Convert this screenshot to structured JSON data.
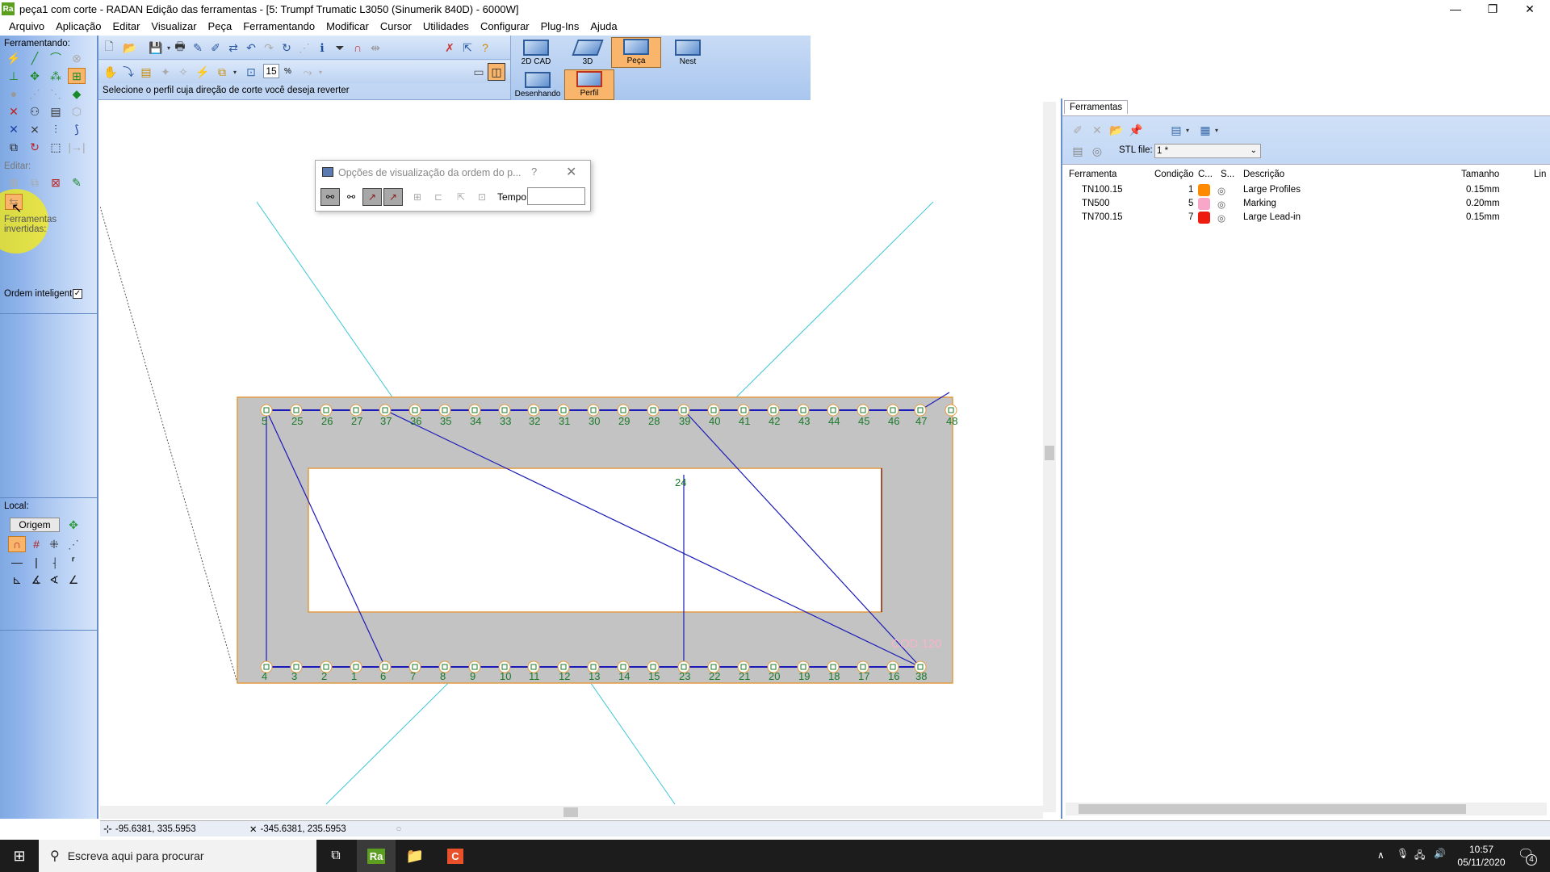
{
  "window": {
    "logo_text": "Ra",
    "title": "peça1 com corte - RADAN Edição das ferramentas - [5: Trumpf Trumatic L3050 (Sinumerik 840D) - 6000W]",
    "controls": {
      "minimize": "—",
      "restore": "❐",
      "close": "✕"
    }
  },
  "menu": [
    "Arquivo",
    "Aplicação",
    "Editar",
    "Visualizar",
    "Peça",
    "Ferramentando",
    "Modificar",
    "Cursor",
    "Utilidades",
    "Configurar",
    "Plug-Ins",
    "Ajuda"
  ],
  "left_panel": {
    "ferramentando_label": "Ferramentando:",
    "editar_label": "Editar:",
    "ferramentas_invertidas_label": "Ferramentas invertidas:",
    "ordem_inteligente_label": "Ordem inteligente",
    "ordem_inteligente_checked": true,
    "local_label": "Local:",
    "origem_button": "Origem"
  },
  "toolbar": {
    "zoom_value": "15",
    "zoom_unit": "%",
    "hint": "Selecione o perfil cuja direção de corte você deseja reverter"
  },
  "modes": {
    "top": [
      {
        "label": "2D CAD",
        "active": false
      },
      {
        "label": "3D",
        "active": false
      },
      {
        "label": "Peça",
        "active": true
      },
      {
        "label": "Nest",
        "active": false
      }
    ],
    "bottom": [
      {
        "label": "Desenhando",
        "active": false
      },
      {
        "label": "Perfil",
        "active": true
      }
    ]
  },
  "dialog": {
    "title": "Opções de visualização da ordem do p...",
    "help": "?",
    "close": "✕",
    "tempo_label": "Tempo:",
    "tempo_value": ""
  },
  "drawing": {
    "top_labels": [
      "5",
      "25",
      "26",
      "27",
      "37",
      "36",
      "35",
      "34",
      "33",
      "32",
      "31",
      "30",
      "29",
      "28",
      "39",
      "40",
      "41",
      "42",
      "43",
      "44",
      "45",
      "46",
      "47",
      "48"
    ],
    "bottom_labels": [
      "4",
      "3",
      "2",
      "1",
      "6",
      "7",
      "8",
      "9",
      "10",
      "11",
      "12",
      "13",
      "14",
      "15",
      "23",
      "22",
      "21",
      "20",
      "19",
      "18",
      "17",
      "16",
      "38"
    ],
    "inner_label": "24",
    "watermark": "COD 120"
  },
  "right_panel": {
    "tab": "Ferramentas",
    "stl_label": "STL file:",
    "stl_value": "1 *",
    "columns": [
      "Ferramenta",
      "Condição",
      "C...",
      "S...",
      "Descrição",
      "Tamanho",
      "Lin"
    ],
    "rows": [
      {
        "tool": "TN100.15",
        "condition": "1",
        "color": "#ff8a00",
        "description": "Large Profiles",
        "size": "0.15mm"
      },
      {
        "tool": "TN500",
        "condition": "5",
        "color": "#f7a7c8",
        "description": "Marking",
        "size": "0.20mm"
      },
      {
        "tool": "TN700.15",
        "condition": "7",
        "color": "#ee1c0e",
        "description": "Large Lead-in",
        "size": "0.15mm"
      }
    ]
  },
  "statusbar": {
    "coord1": "-95.6381, 335.5953",
    "coord2": "-345.6381, 235.5953"
  },
  "taskbar": {
    "search_placeholder": "Escreva aqui para procurar",
    "time": "10:57",
    "date": "05/11/2020",
    "notifications": "4"
  }
}
